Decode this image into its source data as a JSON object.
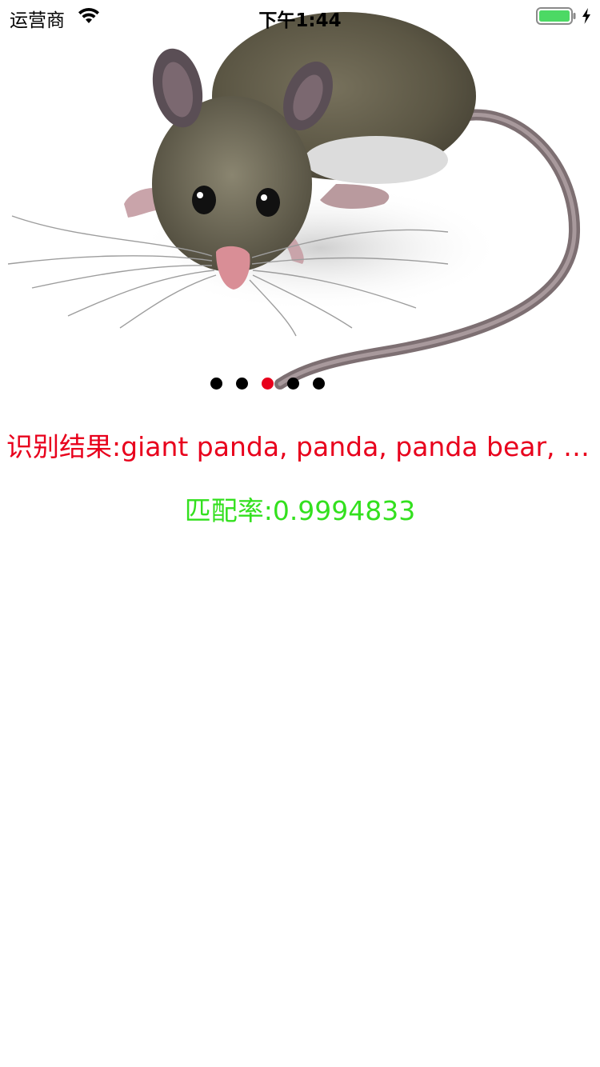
{
  "status_bar": {
    "carrier": "运营商",
    "time": "下午1:44",
    "wifi_icon": "wifi-icon",
    "battery_icon": "battery-icon",
    "charging_icon": "charging-bolt-icon",
    "battery_color": "#4cd964"
  },
  "carousel": {
    "image_icon": "mouse-image",
    "page_count": 5,
    "current_page_index": 2,
    "dot_color": "#000000",
    "active_dot_color": "#e8001c"
  },
  "result": {
    "text": "识别结果:giant panda, panda, panda bear, coon bear, Ailuropoda melanoleuca",
    "color": "#e8001c"
  },
  "match": {
    "text": "匹配率:0.9994833",
    "color": "#33e01e"
  }
}
